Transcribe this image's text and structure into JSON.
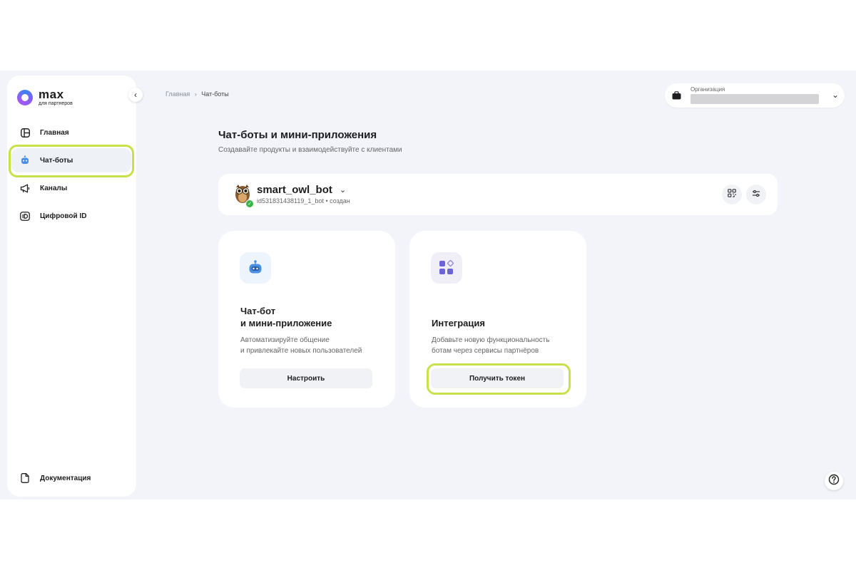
{
  "colors": {
    "background": "#f2f4f9",
    "highlight": "#c6e14a",
    "accent_status": "#38b54a"
  },
  "logo": {
    "wordmark": "max",
    "tagline": "для партнеров"
  },
  "sidebar": {
    "items": [
      {
        "label": "Главная",
        "icon": "dashboard-icon"
      },
      {
        "label": "Чат-боты",
        "icon": "bot-icon"
      },
      {
        "label": "Каналы",
        "icon": "megaphone-icon"
      },
      {
        "label": "Цифровой ID",
        "icon": "id-badge-icon"
      }
    ],
    "footer": {
      "label": "Документация",
      "icon": "document-icon"
    }
  },
  "breadcrumb": {
    "home": "Главная",
    "sep": "›",
    "current": "Чат-боты"
  },
  "org": {
    "label": "Организация"
  },
  "page": {
    "title": "Чат-боты и мини-приложения",
    "subtitle": "Создавайте продукты и взаимодействуйте с клиентами"
  },
  "bot": {
    "name": "smart_owl_bot",
    "id_text": "id531831438119_1_bot",
    "status": "• создан"
  },
  "cards": [
    {
      "title": "Чат-бот\nи мини-приложение",
      "description": "Автоматизируйте общение\nи привлекайте новых пользователей",
      "button": "Настроить",
      "icon": "robot-icon"
    },
    {
      "title": "Интеграция",
      "description": "Добавьте новую функциональность\nботам через сервисы партнёров",
      "button": "Получить токен",
      "icon": "apps-grid-icon"
    }
  ]
}
